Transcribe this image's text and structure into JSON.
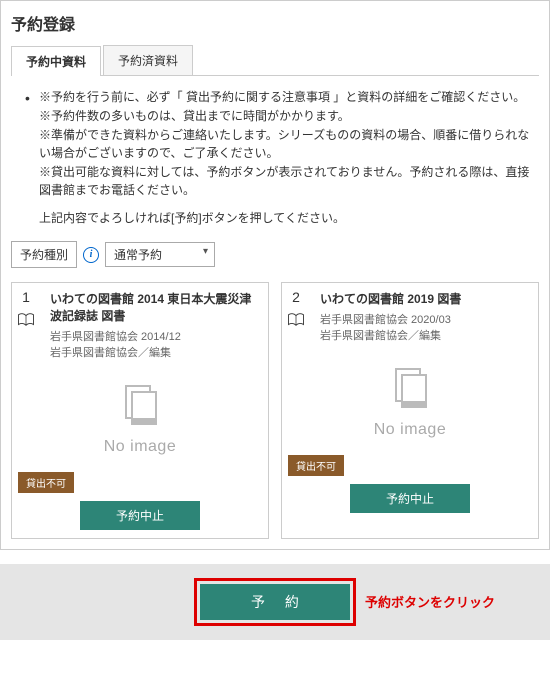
{
  "page_title": "予約登録",
  "tabs": [
    {
      "label": "予約中資料",
      "active": true
    },
    {
      "label": "予約済資料",
      "active": false
    }
  ],
  "info_lines": [
    "※予約を行う前に、必ず「 貸出予約に関する注意事項 」と資料の詳細をご確認ください。",
    "※予約件数の多いものは、貸出までに時間がかかります。",
    "※準備ができた資料からご連絡いたします。シリーズものの資料の場合、順番に借りられない場合がございますので、ご了承ください。",
    "※貸出可能な資料に対しては、予約ボタンが表示されておりません。予約される際は、直接図書館までお電話ください。",
    "上記内容でよろしければ[予約]ボタンを押してください。"
  ],
  "type_label": "予約種別",
  "type_value": "通常予約",
  "cards": [
    {
      "num": "1",
      "title": "いわての図書館 2014 東日本大震災津波記録誌 図書",
      "meta1": "岩手県図書館協会 2014/12",
      "meta2": "岩手県図書館協会／編集",
      "noimg": "No image",
      "badge": "貸出不可",
      "cancel": "予約中止"
    },
    {
      "num": "2",
      "title": "いわての図書館 2019 図書",
      "meta1": "岩手県図書館協会 2020/03",
      "meta2": "岩手県図書館協会／編集",
      "noimg": "No image",
      "badge": "貸出不可",
      "cancel": "予約中止"
    }
  ],
  "reserve_button": "予 約",
  "reserve_note": "予約ボタンをクリック"
}
